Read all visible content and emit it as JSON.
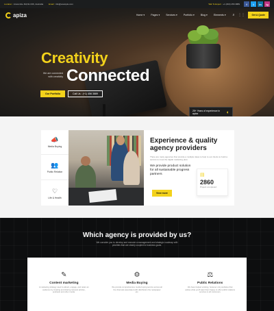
{
  "topbar": {
    "location_label": "Location :",
    "location_value": "Anscombe Rd,NH 23K, Australia",
    "email_label": "Email :",
    "email_value": "info@example.com",
    "call_label": "Talk To Expert :",
    "call_value": "+1 (463) 456 3889",
    "social": [
      "f",
      "t",
      "in",
      "ig"
    ]
  },
  "nav": {
    "brand": "apiza",
    "items": [
      "Home",
      "Pages",
      "Services",
      "Portfolio",
      "Blog",
      "Elements"
    ],
    "cta": "Get A Quote",
    "icons": [
      "search-icon",
      "grid-icon"
    ]
  },
  "hero": {
    "title_top": "Creativity",
    "subtitle": "We are connected with creativity",
    "title_bottom": "Connected",
    "btn_primary": "Our Portfolio",
    "btn_secondary": "Call Us : (+1) 456 3889",
    "badge_text": "25+ Years of experience in apiza"
  },
  "services_side": [
    {
      "label": "Media Buying",
      "icon": "megaphone-icon"
    },
    {
      "label": "Public Relation",
      "icon": "team-icon"
    },
    {
      "label": "Life & Health",
      "icon": "health-icon"
    }
  ],
  "experience": {
    "title": "Experience & quality agency providers",
    "text": "There are many agencies that provide a multiple ideas to help to our clients to build a service to meet the digital marketing plan.",
    "bold": "We provide product solution for all sustainable progress partners",
    "stat_number": "2860",
    "stat_label": "Project completed",
    "view_more": "View more"
  },
  "agency": {
    "title": "Which agency is provided by us?",
    "subtitle": "We consider you to develop and execute a management and strategic roadmap with priorities that are clearly coupled to business goals.",
    "cards": [
      {
        "title": "Content marketing",
        "icon": "content-icon",
        "desc": "A marketing strategy used to attract, engage, and retain an audience by creating and sharing relevant articles, podcasts and other media."
      },
      {
        "title": "Media Buying",
        "icon": "media-icon",
        "desc": "We provide comprehensive media buying service across all the channels associated with distribution the newspaper etc."
      },
      {
        "title": "Public Relations",
        "icon": "relations-icon",
        "desc": "We have helped existing, however only websites that advise what you'll want them happy to offer public relations services to all customers."
      }
    ]
  },
  "colors": {
    "accent": "#f3d21b",
    "dark": "#0d0e0f"
  }
}
